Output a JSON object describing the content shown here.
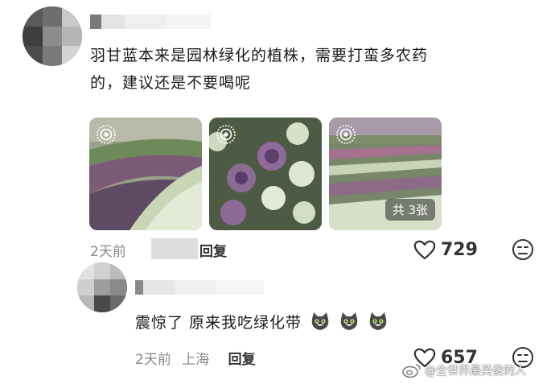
{
  "comment1": {
    "text_line1": "羽甘蓝本来是园林绿化的植株，需要打蛮多农药",
    "text_line2": "的，建议还是不要喝呢",
    "time": "2天前",
    "reply_label": "回复",
    "likes": "729",
    "image_badge": "共 3张",
    "images": [
      {
        "subject": "ornamental kale field rows"
      },
      {
        "subject": "ornamental kale close-up"
      },
      {
        "subject": "ornamental kale field landscape"
      }
    ]
  },
  "comment2": {
    "text": "震惊了 原来我吃绿化带",
    "emoji_count": 3,
    "time": "2天前",
    "location": "上海",
    "reply_label": "回复",
    "likes": "657"
  },
  "watermark": "@全世界最英俊的人",
  "icons": {
    "like": "heart-outline-icon",
    "dislike": "frown-face-icon",
    "live": "live-photo-icon",
    "emoji": "cat-face-emoji-icon",
    "weibo": "weibo-logo-icon"
  },
  "colors": {
    "text": "#1a1a1a",
    "meta": "#888888"
  }
}
